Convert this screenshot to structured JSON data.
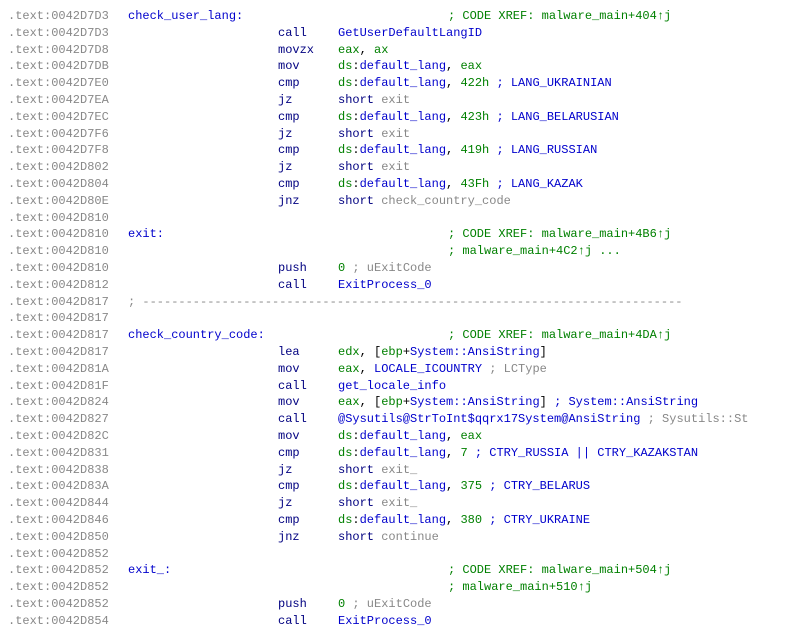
{
  "lines": [
    {
      "addr": ".text:0042D7D3",
      "label": "check_user_lang:",
      "op": "",
      "args": [],
      "comment_pre": "",
      "xref": "; CODE XREF: malware_main+404↑j"
    },
    {
      "addr": ".text:0042D7D3",
      "label": "",
      "op": "call",
      "args": [
        {
          "t": "sym",
          "v": "GetUserDefaultLangID"
        }
      ]
    },
    {
      "addr": ".text:0042D7D8",
      "label": "",
      "op": "movzx",
      "args": [
        {
          "t": "reg",
          "v": "eax"
        },
        {
          "t": "p",
          "v": ", "
        },
        {
          "t": "reg",
          "v": "ax"
        }
      ]
    },
    {
      "addr": ".text:0042D7DB",
      "label": "",
      "op": "mov",
      "args": [
        {
          "t": "reg",
          "v": "ds"
        },
        {
          "t": "p",
          "v": ":"
        },
        {
          "t": "sym",
          "v": "default_lang"
        },
        {
          "t": "p",
          "v": ", "
        },
        {
          "t": "reg",
          "v": "eax"
        }
      ]
    },
    {
      "addr": ".text:0042D7E0",
      "label": "",
      "op": "cmp",
      "args": [
        {
          "t": "reg",
          "v": "ds"
        },
        {
          "t": "p",
          "v": ":"
        },
        {
          "t": "sym",
          "v": "default_lang"
        },
        {
          "t": "p",
          "v": ", "
        },
        {
          "t": "num",
          "v": "422h"
        }
      ],
      "comment": " ; LANG_UKRAINIAN",
      "commentClass": "sym"
    },
    {
      "addr": ".text:0042D7EA",
      "label": "",
      "op": "jz",
      "args": [
        {
          "t": "op",
          "v": "short "
        },
        {
          "t": "gray",
          "v": "exit"
        }
      ]
    },
    {
      "addr": ".text:0042D7EC",
      "label": "",
      "op": "cmp",
      "args": [
        {
          "t": "reg",
          "v": "ds"
        },
        {
          "t": "p",
          "v": ":"
        },
        {
          "t": "sym",
          "v": "default_lang"
        },
        {
          "t": "p",
          "v": ", "
        },
        {
          "t": "num",
          "v": "423h"
        }
      ],
      "comment": " ; LANG_BELARUSIAN",
      "commentClass": "sym"
    },
    {
      "addr": ".text:0042D7F6",
      "label": "",
      "op": "jz",
      "args": [
        {
          "t": "op",
          "v": "short "
        },
        {
          "t": "gray",
          "v": "exit"
        }
      ]
    },
    {
      "addr": ".text:0042D7F8",
      "label": "",
      "op": "cmp",
      "args": [
        {
          "t": "reg",
          "v": "ds"
        },
        {
          "t": "p",
          "v": ":"
        },
        {
          "t": "sym",
          "v": "default_lang"
        },
        {
          "t": "p",
          "v": ", "
        },
        {
          "t": "num",
          "v": "419h"
        }
      ],
      "comment": " ; LANG_RUSSIAN",
      "commentClass": "sym"
    },
    {
      "addr": ".text:0042D802",
      "label": "",
      "op": "jz",
      "args": [
        {
          "t": "op",
          "v": "short "
        },
        {
          "t": "gray",
          "v": "exit"
        }
      ]
    },
    {
      "addr": ".text:0042D804",
      "label": "",
      "op": "cmp",
      "args": [
        {
          "t": "reg",
          "v": "ds"
        },
        {
          "t": "p",
          "v": ":"
        },
        {
          "t": "sym",
          "v": "default_lang"
        },
        {
          "t": "p",
          "v": ", "
        },
        {
          "t": "num",
          "v": "43Fh"
        }
      ],
      "comment": " ; LANG_KAZAK",
      "commentClass": "sym"
    },
    {
      "addr": ".text:0042D80E",
      "label": "",
      "op": "jnz",
      "args": [
        {
          "t": "op",
          "v": "short "
        },
        {
          "t": "gray",
          "v": "check_country_code"
        }
      ]
    },
    {
      "addr": ".text:0042D810",
      "label": "",
      "op": "",
      "args": []
    },
    {
      "addr": ".text:0042D810",
      "label": "exit:",
      "op": "",
      "args": [],
      "xref": "; CODE XREF: malware_main+4B6↑j"
    },
    {
      "addr": ".text:0042D810",
      "label": "",
      "op": "",
      "args": [],
      "xref": "; malware_main+4C2↑j ..."
    },
    {
      "addr": ".text:0042D810",
      "label": "",
      "op": "push",
      "args": [
        {
          "t": "num",
          "v": "0"
        }
      ],
      "comment": "             ; uExitCode",
      "commentClass": "gray"
    },
    {
      "addr": ".text:0042D812",
      "label": "",
      "op": "call",
      "args": [
        {
          "t": "sym",
          "v": "ExitProcess_0"
        }
      ]
    },
    {
      "addr": ".text:0042D817",
      "dashes": true
    },
    {
      "addr": ".text:0042D817",
      "label": "",
      "op": "",
      "args": []
    },
    {
      "addr": ".text:0042D817",
      "label": "check_country_code:",
      "op": "",
      "args": [],
      "xref": "; CODE XREF: malware_main+4DA↑j"
    },
    {
      "addr": ".text:0042D817",
      "label": "",
      "op": "lea",
      "args": [
        {
          "t": "reg",
          "v": "edx"
        },
        {
          "t": "p",
          "v": ", ["
        },
        {
          "t": "reg",
          "v": "ebp"
        },
        {
          "t": "p",
          "v": "+"
        },
        {
          "t": "sym",
          "v": "System::AnsiString"
        },
        {
          "t": "p",
          "v": "]"
        }
      ]
    },
    {
      "addr": ".text:0042D81A",
      "label": "",
      "op": "mov",
      "args": [
        {
          "t": "reg",
          "v": "eax"
        },
        {
          "t": "p",
          "v": ", "
        },
        {
          "t": "sym",
          "v": "LOCALE_ICOUNTRY"
        }
      ],
      "comment": " ; LCType",
      "commentClass": "gray"
    },
    {
      "addr": ".text:0042D81F",
      "label": "",
      "op": "call",
      "args": [
        {
          "t": "sym",
          "v": "get_locale_info"
        }
      ]
    },
    {
      "addr": ".text:0042D824",
      "label": "",
      "op": "mov",
      "args": [
        {
          "t": "reg",
          "v": "eax"
        },
        {
          "t": "p",
          "v": ", ["
        },
        {
          "t": "reg",
          "v": "ebp"
        },
        {
          "t": "p",
          "v": "+"
        },
        {
          "t": "sym",
          "v": "System::AnsiString"
        },
        {
          "t": "p",
          "v": "] "
        }
      ],
      "comment": "; System::AnsiString",
      "commentClass": "sym"
    },
    {
      "addr": ".text:0042D827",
      "label": "",
      "op": "call",
      "args": [
        {
          "t": "sym",
          "v": "@Sysutils@StrToInt$qqrx17System@AnsiString"
        }
      ],
      "comment": " ; Sysutils::St",
      "commentClass": "gray"
    },
    {
      "addr": ".text:0042D82C",
      "label": "",
      "op": "mov",
      "args": [
        {
          "t": "reg",
          "v": "ds"
        },
        {
          "t": "p",
          "v": ":"
        },
        {
          "t": "sym",
          "v": "default_lang"
        },
        {
          "t": "p",
          "v": ", "
        },
        {
          "t": "reg",
          "v": "eax"
        }
      ]
    },
    {
      "addr": ".text:0042D831",
      "label": "",
      "op": "cmp",
      "args": [
        {
          "t": "reg",
          "v": "ds"
        },
        {
          "t": "p",
          "v": ":"
        },
        {
          "t": "sym",
          "v": "default_lang"
        },
        {
          "t": "p",
          "v": ", "
        },
        {
          "t": "num",
          "v": "7"
        }
      ],
      "comment": " ; CTRY_RUSSIA || CTRY_KAZAKSTAN",
      "commentClass": "sym"
    },
    {
      "addr": ".text:0042D838",
      "label": "",
      "op": "jz",
      "args": [
        {
          "t": "op",
          "v": "short "
        },
        {
          "t": "gray",
          "v": "exit_"
        }
      ]
    },
    {
      "addr": ".text:0042D83A",
      "label": "",
      "op": "cmp",
      "args": [
        {
          "t": "reg",
          "v": "ds"
        },
        {
          "t": "p",
          "v": ":"
        },
        {
          "t": "sym",
          "v": "default_lang"
        },
        {
          "t": "p",
          "v": ", "
        },
        {
          "t": "num",
          "v": "375"
        }
      ],
      "comment": " ; CTRY_BELARUS",
      "commentClass": "sym"
    },
    {
      "addr": ".text:0042D844",
      "label": "",
      "op": "jz",
      "args": [
        {
          "t": "op",
          "v": "short "
        },
        {
          "t": "gray",
          "v": "exit_"
        }
      ]
    },
    {
      "addr": ".text:0042D846",
      "label": "",
      "op": "cmp",
      "args": [
        {
          "t": "reg",
          "v": "ds"
        },
        {
          "t": "p",
          "v": ":"
        },
        {
          "t": "sym",
          "v": "default_lang"
        },
        {
          "t": "p",
          "v": ", "
        },
        {
          "t": "num",
          "v": "380"
        }
      ],
      "comment": " ; CTRY_UKRAINE",
      "commentClass": "sym"
    },
    {
      "addr": ".text:0042D850",
      "label": "",
      "op": "jnz",
      "args": [
        {
          "t": "op",
          "v": "short "
        },
        {
          "t": "gray",
          "v": "continue"
        }
      ]
    },
    {
      "addr": ".text:0042D852",
      "label": "",
      "op": "",
      "args": []
    },
    {
      "addr": ".text:0042D852",
      "label": "exit_:",
      "op": "",
      "args": [],
      "xref": "; CODE XREF: malware_main+504↑j"
    },
    {
      "addr": ".text:0042D852",
      "label": "",
      "op": "",
      "args": [],
      "xref": "; malware_main+510↑j"
    },
    {
      "addr": ".text:0042D852",
      "label": "",
      "op": "push",
      "args": [
        {
          "t": "num",
          "v": "0"
        }
      ],
      "comment": "             ; uExitCode",
      "commentClass": "gray"
    },
    {
      "addr": ".text:0042D854",
      "label": "",
      "op": "call",
      "args": [
        {
          "t": "sym",
          "v": "ExitProcess_0"
        }
      ]
    }
  ],
  "dash_fill": " ; ---------------------------------------------------------------------------"
}
